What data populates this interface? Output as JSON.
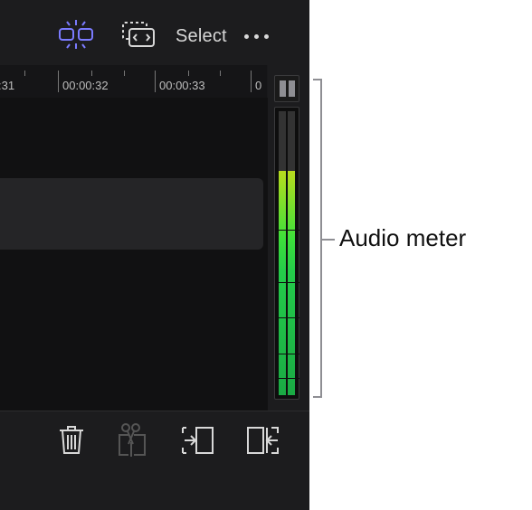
{
  "toolbar": {
    "select_label": "Select",
    "icons": [
      "snapping-icon",
      "transform-icon",
      "more-icon"
    ],
    "active_color": "#7b7bff"
  },
  "ruler": {
    "timecodes": [
      ":31",
      "00:00:32",
      "00:00:33",
      "0"
    ]
  },
  "meter": {
    "left_level": 0.79,
    "right_level": 0.79,
    "colors": {
      "low": "#1aaa44",
      "high": "#b8dc1e"
    }
  },
  "bottom_toolbar": {
    "icons": [
      "trash-icon",
      "split-icon",
      "move-in-icon",
      "move-out-icon"
    ]
  },
  "callout": {
    "label": "Audio meter"
  }
}
